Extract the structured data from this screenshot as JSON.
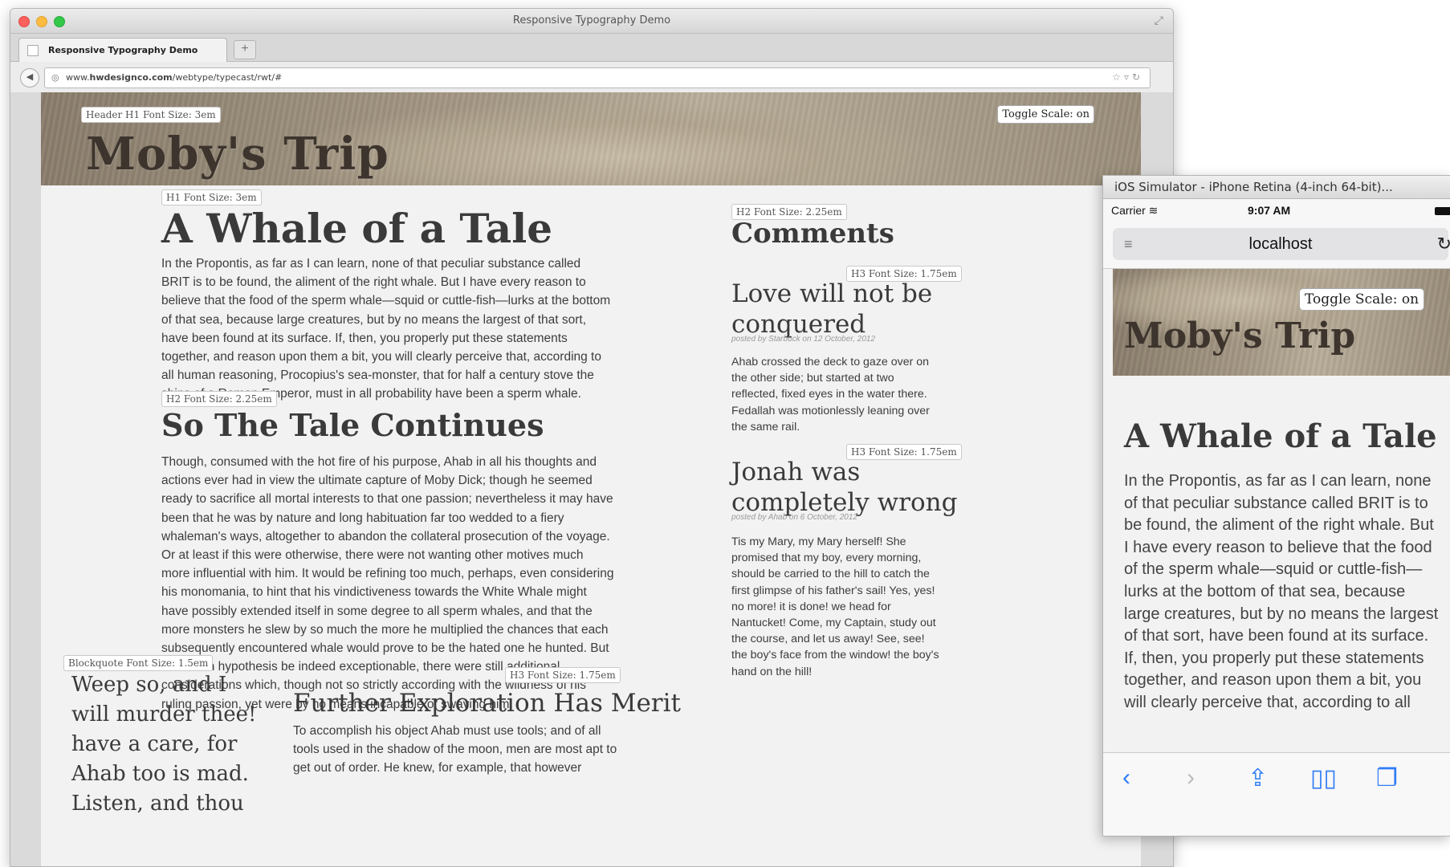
{
  "browser": {
    "window_title": "Responsive Typography Demo",
    "tab_label": "Responsive Typography Demo",
    "url_prefix": "www.",
    "url_domain": "hwdesignco.com",
    "url_path": "/webtype/typecast/rwt/#"
  },
  "page": {
    "header_tag": "Header H1 Font Size: 3em",
    "site_title": "Moby's Trip",
    "toggle_label": "Toggle Scale: on",
    "main": {
      "h1_tag": "H1 Font Size: 3em",
      "h1": "A Whale of a Tale",
      "p1": "In the Propontis, as far as I can learn, none of that peculiar substance called BRIT is to be found, the aliment of the right whale. But I have every reason to believe that the food of the sperm whale—squid or cuttle-fish—lurks at the bottom of that sea, because large creatures, but by no means the largest of that sort, have been found at its surface. If, then, you properly put these statements together, and reason upon them a bit, you will clearly perceive that, according to all human reasoning, Procopius's sea-monster, that for half a century stove the ships of a Roman Emperor, must in all probability have been a sperm whale.",
      "h2_tag": "H2 Font Size: 2.25em",
      "h2": "So The Tale Continues",
      "p2": "Though, consumed with the hot fire of his purpose, Ahab in all his thoughts and actions ever had in view the ultimate capture of Moby Dick; though he seemed ready to sacrifice all mortal interests to that one passion; nevertheless it may have been that he was by nature and long habituation far too wedded to a fiery whaleman's ways, altogether to abandon the collateral prosecution of the voyage. Or at least if this were otherwise, there were not wanting other motives much more influential with him. It would be refining too much, perhaps, even considering his monomania, to hint that his vindictiveness towards the White Whale might have possibly extended itself in some degree to all sperm whales, and that the more monsters he slew by so much the more he multiplied the chances that each subsequently encountered whale would prove to be the hated one he hunted. But if such an hypothesis be indeed exceptionable, there were still additional considerations which, though not so strictly according with the wildness of his ruling passion, yet were by no means incapable of swaying him.",
      "blockquote_tag": "Blockquote Font Size: 1.5em",
      "blockquote": "Weep so, and I will murder thee! have a care, for Ahab too is mad. Listen, and thou",
      "h3_tag": "H3 Font Size: 1.75em",
      "h3": "Further Exploration Has Merit",
      "p3": "To accomplish his object Ahab must use tools; and of all tools used in the shadow of the moon, men are most apt to get out of order. He knew, for example, that however"
    },
    "comments": {
      "h2_tag": "H2 Font Size: 2.25em",
      "title": "Comments",
      "items": [
        {
          "tag": "H3 Font Size: 1.75em",
          "title": "Love will not be conquered",
          "posted": "posted by Starbuck on 12 October, 2012",
          "body": "Ahab crossed the deck to gaze over on the other side; but started at two reflected, fixed eyes in the water there. Fedallah was motionlessly leaning over the same rail."
        },
        {
          "tag": "H3 Font Size: 1.75em",
          "title": "Jonah was completely wrong",
          "posted": "posted by Ahab on 6 October, 2012",
          "body": "Tis my Mary, my Mary herself! She promised that my boy, every morning, should be carried to the hill to catch the first glimpse of his father's sail! Yes, yes! no more! it is done! we head for Nantucket! Come, my Captain, study out the course, and let us away! See, see! the boy's face from the window! the boy's hand on the hill!"
        }
      ]
    }
  },
  "simulator": {
    "window_title": "iOS Simulator - iPhone Retina (4-inch 64-bit)...",
    "carrier": "Carrier",
    "time": "9:07 AM",
    "address": "localhost",
    "site_title": "Moby's Trip",
    "toggle_label": "Toggle Scale: on",
    "h1": "A Whale of a Tale",
    "p1": "In the Propontis, as far as I can learn, none of that peculiar substance called BRIT is to be found, the aliment of the right whale. But I have every reason to believe that the food of the sperm whale—squid or cuttle-fish—lurks at the bottom of that sea, because large creatures, but by no means the largest of that sort, have been found at its surface. If, then, you properly put these statements together, and reason upon them a bit, you will clearly perceive that, according to all human reasoning, Procopius's sea-monster"
  }
}
